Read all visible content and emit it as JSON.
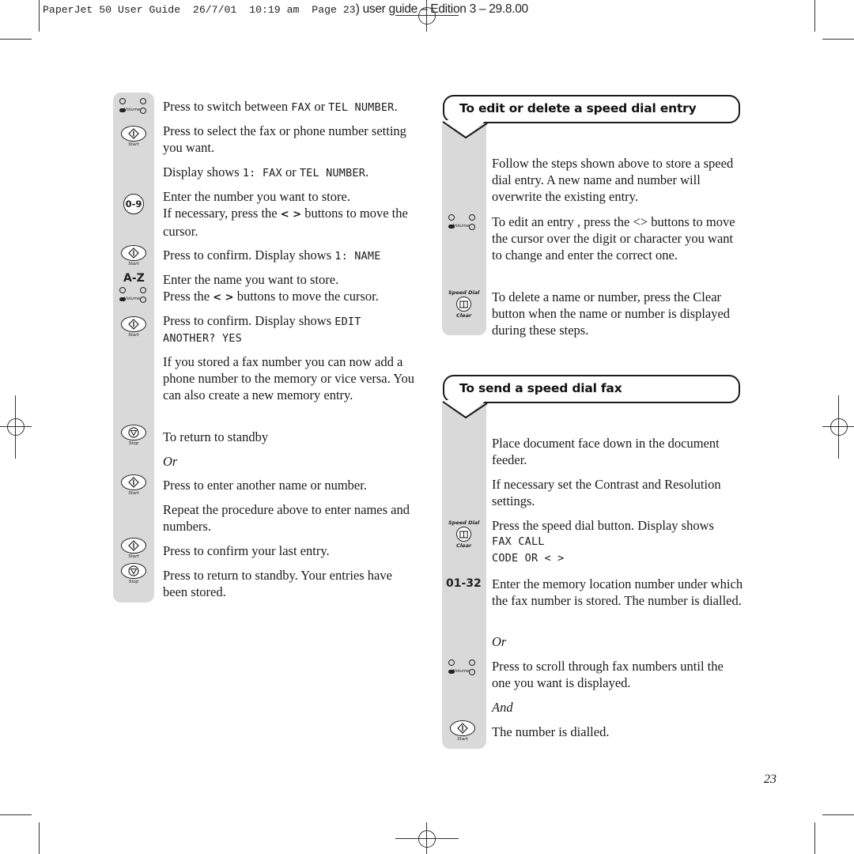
{
  "slug": {
    "file_info": "PaperJet 50 User Guide  26/7/01  10:19 am  Page 23",
    "edition": ") user guide – Edition 3 – 29.8.00"
  },
  "icons": {
    "volume_label": "Volume",
    "start_label": "Start",
    "stop_label": "Stop",
    "speed_dial_label": "Speed Dial",
    "clear_label": "Clear",
    "digits_key": "0-9",
    "letters_key": "A-Z",
    "memory_key": "01-32"
  },
  "left_column": {
    "steps": [
      {
        "icon": "volume-buttons",
        "text_before": "Press to switch between ",
        "lcd1": "FAX",
        "text_mid": " or ",
        "lcd2": "TEL NUMBER",
        "text_after": "."
      },
      {
        "icon": "start-button",
        "text": "Press to select the fax or phone number setting you want."
      },
      {
        "icon": "",
        "text_before": "Display shows ",
        "lcd1": "1: FAX",
        "text_mid": " or ",
        "lcd2": "TEL NUMBER",
        "text_after": "."
      },
      {
        "icon": "digits-key",
        "line1": "Enter the number you want to store.",
        "line2_before": "If necessary, press the ",
        "line2_keys": "< >",
        "line2_after": " buttons to move the cursor."
      },
      {
        "icon": "start-button",
        "text_before": "Press to confirm. Display shows ",
        "lcd1": "1: NAME"
      },
      {
        "icon": "letters-key",
        "line1": "Enter the name you want to store."
      },
      {
        "icon": "volume-buttons",
        "line2_before": "Press the ",
        "line2_keys": "< >",
        "line2_after": " buttons to move the cursor."
      },
      {
        "icon": "start-button",
        "text_before": "Press to confirm. Display shows ",
        "lcd1": "EDIT",
        "lcd2": "ANOTHER? YES"
      },
      {
        "icon": "",
        "text": "If you stored a fax number you can now add a phone number to the memory or vice versa. You can also create a new memory entry."
      },
      {
        "icon": "stop-button",
        "text": "To return to standby"
      },
      {
        "icon": "",
        "text": "Or",
        "italic": true
      },
      {
        "icon": "start-button",
        "text": "Press to enter another name or number."
      },
      {
        "icon": "",
        "text": "Repeat the procedure above to enter names and numbers."
      },
      {
        "icon": "start-button",
        "text": "Press to confirm your last entry."
      },
      {
        "icon": "stop-button",
        "text": "Press to return to standby. Your entries have been stored."
      }
    ]
  },
  "sections": [
    {
      "title": "To edit or delete a speed dial entry",
      "steps": [
        {
          "icon": "",
          "text": "Follow the steps shown above to store a speed dial entry. A new name and number will overwrite the existing entry."
        },
        {
          "icon": "volume-buttons",
          "text": "To edit an entry , press the <> buttons to move the cursor over the digit or character you want to change and enter the correct one."
        },
        {
          "icon": "speed-dial-button",
          "text": "To delete a name or number, press the Clear button when the name or number is displayed during these steps."
        }
      ]
    },
    {
      "title": "To send a speed dial fax",
      "steps": [
        {
          "icon": "",
          "text": "Place document face down in the document feeder."
        },
        {
          "icon": "",
          "text": "If necessary set the Contrast and Resolution settings."
        },
        {
          "icon": "speed-dial-button",
          "text": "Press the speed dial button. Display shows",
          "lcd1": "FAX CALL",
          "lcd2": "CODE OR < >"
        },
        {
          "icon": "memory-key",
          "text": "Enter the memory location number under which the fax number is stored. The number is dialled."
        },
        {
          "icon": "",
          "text": "Or",
          "italic": true
        },
        {
          "icon": "volume-buttons",
          "text": "Press to scroll through fax numbers until the one you want is displayed."
        },
        {
          "icon": "",
          "text": "And",
          "italic": true
        },
        {
          "icon": "start-button",
          "text": "The number is dialled."
        }
      ]
    }
  ],
  "page_number": "23"
}
